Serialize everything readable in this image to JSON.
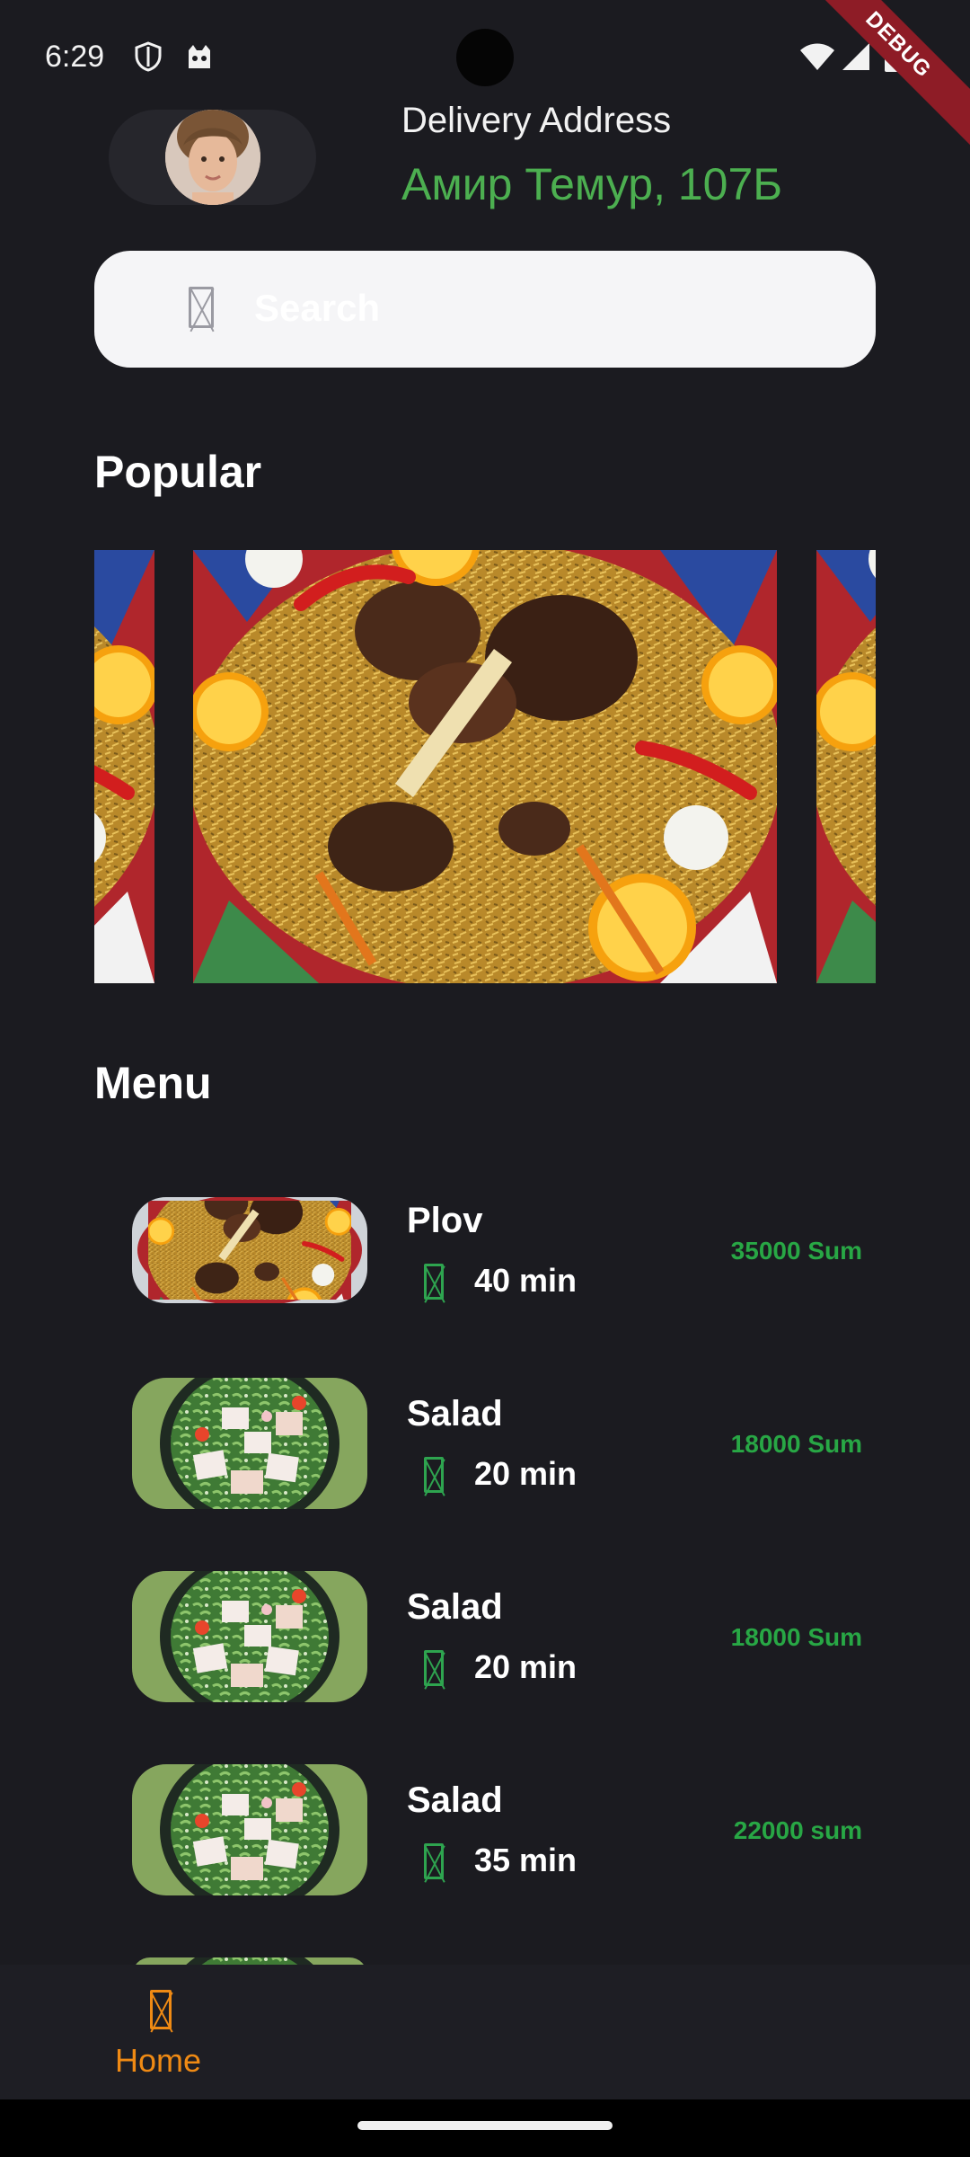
{
  "status_bar": {
    "time": "6:29",
    "left_icons": [
      "shield-icon",
      "cat-face-icon"
    ],
    "right_icons": [
      "wifi-icon",
      "signal-icon",
      "battery-icon"
    ],
    "debug_banner": "DEBUG"
  },
  "header": {
    "address_label": "Delivery Address",
    "address_value": "Амир Темур, 107Б"
  },
  "search": {
    "placeholder": "Search",
    "value": ""
  },
  "popular": {
    "title": "Popular",
    "dish_images": [
      "plov-photo",
      "plov-photo",
      "plov-photo"
    ]
  },
  "menu": {
    "title": "Menu",
    "items": [
      {
        "name": "Plov",
        "time": "40 min",
        "price": "35000 Sum",
        "image": "plov-photo"
      },
      {
        "name": "Salad",
        "time": "20 min",
        "price": "18000 Sum",
        "image": "salad-photo"
      },
      {
        "name": "Salad",
        "time": "20 min",
        "price": "18000 Sum",
        "image": "salad-photo"
      },
      {
        "name": "Salad",
        "time": "35 min",
        "price": "22000 sum",
        "image": "salad-photo"
      }
    ]
  },
  "bottom_nav": {
    "items": [
      {
        "label": "Home",
        "icon": "home-icon",
        "active": true
      }
    ]
  },
  "colors": {
    "background": "#1b1b20",
    "address_green": "#4caf50",
    "price_green": "#28a745",
    "active_nav": "#ef8a14"
  }
}
